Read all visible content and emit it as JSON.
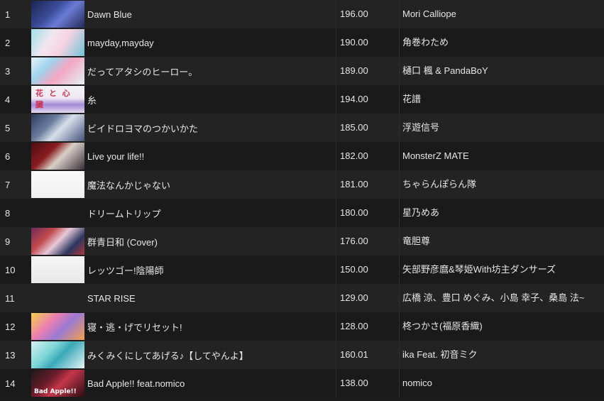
{
  "tracks": [
    {
      "num": "1",
      "title": "Dawn Blue",
      "bpm": "196.00",
      "artist": "Mori Calliope",
      "art": "art-1"
    },
    {
      "num": "2",
      "title": "mayday,mayday",
      "bpm": "190.00",
      "artist": "角巻わため",
      "art": "art-2"
    },
    {
      "num": "3",
      "title": "だってアタシのヒーロー。",
      "bpm": "189.00",
      "artist": "樋口 楓 & PandaBoY",
      "art": "art-3"
    },
    {
      "num": "4",
      "title": "糸",
      "bpm": "194.00",
      "artist": "花譜",
      "art": "art-4",
      "art_text": "花 と 心 臓"
    },
    {
      "num": "5",
      "title": "ビイドロヨマのつかいかた",
      "bpm": "185.00",
      "artist": "浮遊信号",
      "art": "art-5"
    },
    {
      "num": "6",
      "title": "Live your life!!",
      "bpm": "182.00",
      "artist": "MonsterZ MATE",
      "art": "art-6"
    },
    {
      "num": "7",
      "title": "魔法なんかじゃない",
      "bpm": "181.00",
      "artist": "ちゃらんぽらん隊",
      "art": "art-7"
    },
    {
      "num": "8",
      "title": "ドリームトリップ",
      "bpm": "180.00",
      "artist": "星乃めあ",
      "art": "none"
    },
    {
      "num": "9",
      "title": "群青日和 (Cover)",
      "bpm": "176.00",
      "artist": "竜胆尊",
      "art": "art-9"
    },
    {
      "num": "10",
      "title": "レッツゴー!陰陽師",
      "bpm": "150.00",
      "artist": "矢部野彦麿&琴姫With坊主ダンサーズ",
      "art": "art-10"
    },
    {
      "num": "11",
      "title": "STAR RISE",
      "bpm": "129.00",
      "artist": "広橋 涼、豊口 めぐみ、小島 幸子、桑島 法~",
      "art": "none"
    },
    {
      "num": "12",
      "title": "寝・逃・げでリセット!",
      "bpm": "128.00",
      "artist": "柊つかさ(福原香織)",
      "art": "art-12"
    },
    {
      "num": "13",
      "title": "みくみくにしてあげる♪【してやんよ】",
      "bpm": "160.01",
      "artist": "ika Feat. 初音ミク",
      "art": "art-13"
    },
    {
      "num": "14",
      "title": "Bad Apple!! feat.nomico",
      "bpm": "138.00",
      "artist": "nomico",
      "art": "art-14",
      "art_text": "Bad Apple!!"
    }
  ],
  "colors": {
    "row_odd": "#232323",
    "row_even": "#1a1a1a",
    "text": "#e6e6e6"
  }
}
